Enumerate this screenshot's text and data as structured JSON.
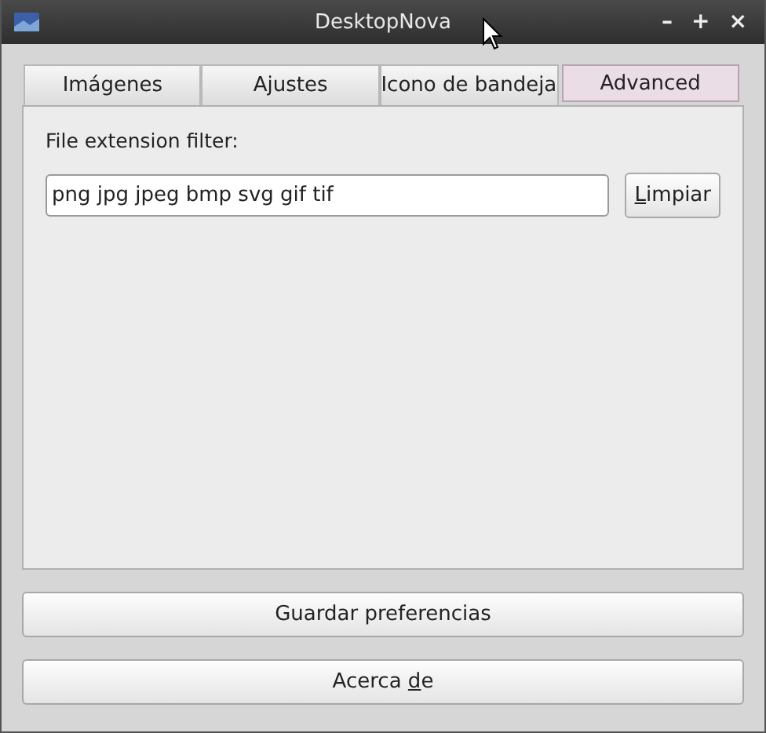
{
  "window": {
    "title": "DesktopNova",
    "controls": [
      "–",
      "+",
      "×"
    ]
  },
  "tabs": [
    {
      "label": "Imágenes",
      "selected": false
    },
    {
      "label": "Ajustes",
      "selected": false
    },
    {
      "label": "Icono de bandeja",
      "selected": false
    },
    {
      "label": "Advanced",
      "selected": true
    }
  ],
  "filter": {
    "label": "File extension filter:",
    "value": "png jpg jpeg bmp svg gif tif",
    "button": {
      "label_parts": [
        {
          "text": "L",
          "underlined": true
        },
        {
          "text": "impiar",
          "underlined": false
        }
      ]
    }
  },
  "buttons": [
    {
      "label_parts": [
        {
          "text": "Guardar preferencias",
          "underlined": false
        }
      ]
    },
    {
      "label_parts": [
        {
          "text": "Acerca ",
          "underlined": false
        },
        {
          "text": "d",
          "underlined": true
        },
        {
          "text": "e",
          "underlined": false
        }
      ]
    }
  ]
}
